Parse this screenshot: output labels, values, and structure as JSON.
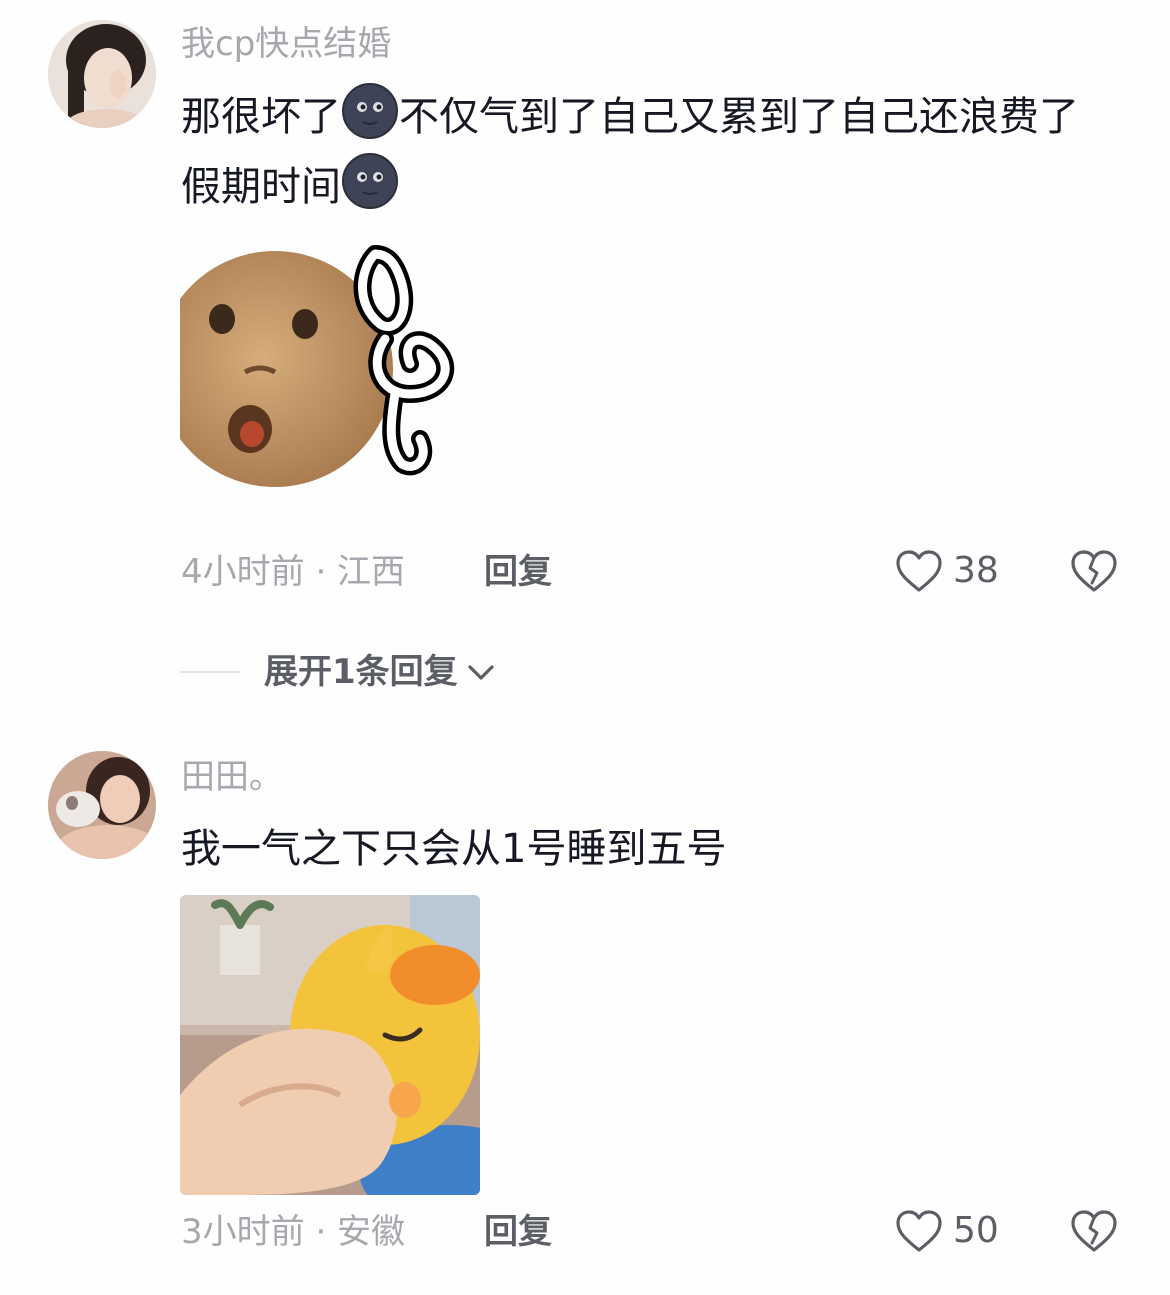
{
  "comments": [
    {
      "username": "我cp快点结婚",
      "text_part1": "那很坏了",
      "text_part2": "不仅气到了自己又累到了自己还浪费了假期时间",
      "emoji": "new-moon-face",
      "time_location": "4小时前 · 江西",
      "reply_label": "回复",
      "likes": "38"
    },
    {
      "username": "田田。",
      "text": "我一气之下只会从1号睡到五号",
      "time_location": "3小时前 · 安徽",
      "reply_label": "回复",
      "likes": "50"
    }
  ],
  "expand_replies": {
    "label": "展开1条回复"
  },
  "colors": {
    "secondary_text": "#a7a8ad",
    "action_text": "#5c5e66",
    "primary_text": "#161823"
  }
}
